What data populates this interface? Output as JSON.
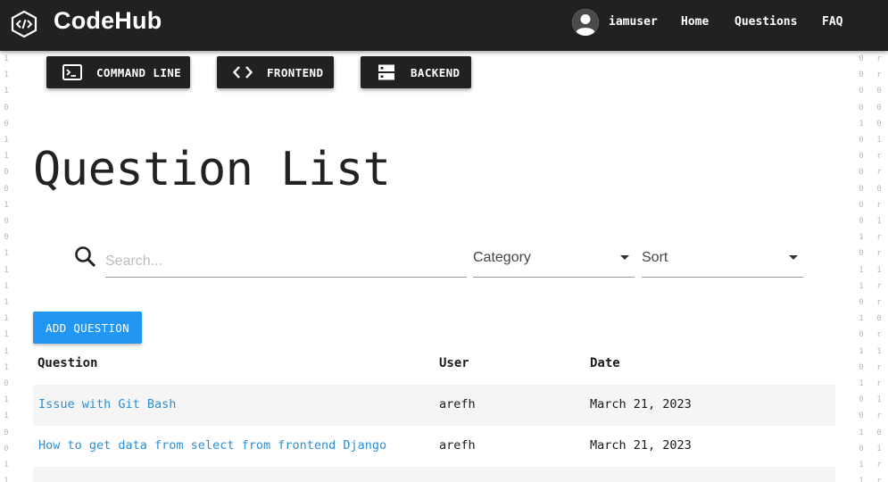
{
  "brand": {
    "name": "CodeHub",
    "logo_icon": "code-brackets-icon"
  },
  "nav": {
    "username": "iamuser",
    "items": [
      "Home",
      "Questions",
      "FAQ"
    ]
  },
  "categories": [
    {
      "label": "COMMAND LINE",
      "icon": "terminal-icon"
    },
    {
      "label": "FRONTEND",
      "icon": "code-icon"
    },
    {
      "label": "BACKEND",
      "icon": "server-icon"
    }
  ],
  "page": {
    "title": "Question List"
  },
  "filters": {
    "search_placeholder": "Search...",
    "category_label": "Category",
    "sort_label": "Sort"
  },
  "actions": {
    "add_question": "ADD QUESTION"
  },
  "table": {
    "headers": [
      "Question",
      "User",
      "Date"
    ],
    "rows": [
      {
        "question": "Issue with Git Bash",
        "user": "arefh",
        "date": "March 21, 2023"
      },
      {
        "question": "How to get data from select from frontend Django",
        "user": "arefh",
        "date": "March 21, 2023"
      }
    ]
  },
  "colors": {
    "topbar": "#212121",
    "accent": "#2196f3",
    "link": "#2a8fd6"
  }
}
